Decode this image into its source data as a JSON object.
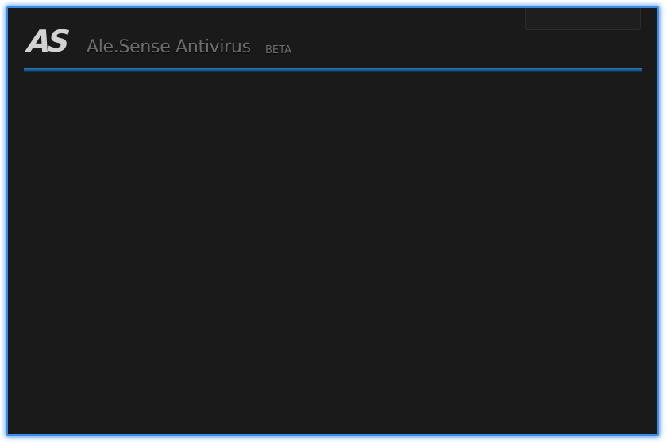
{
  "app": {
    "logo_text": "AS",
    "title": "Ale.Sense Antivirus",
    "badge": "BETA"
  },
  "colors": {
    "window_background": "#1a1a1a",
    "window_border": "#3a8de6",
    "accent_divider": "#1c5a92",
    "title_text": "#6e6e6e",
    "logo_text": "#d2d2d2"
  }
}
